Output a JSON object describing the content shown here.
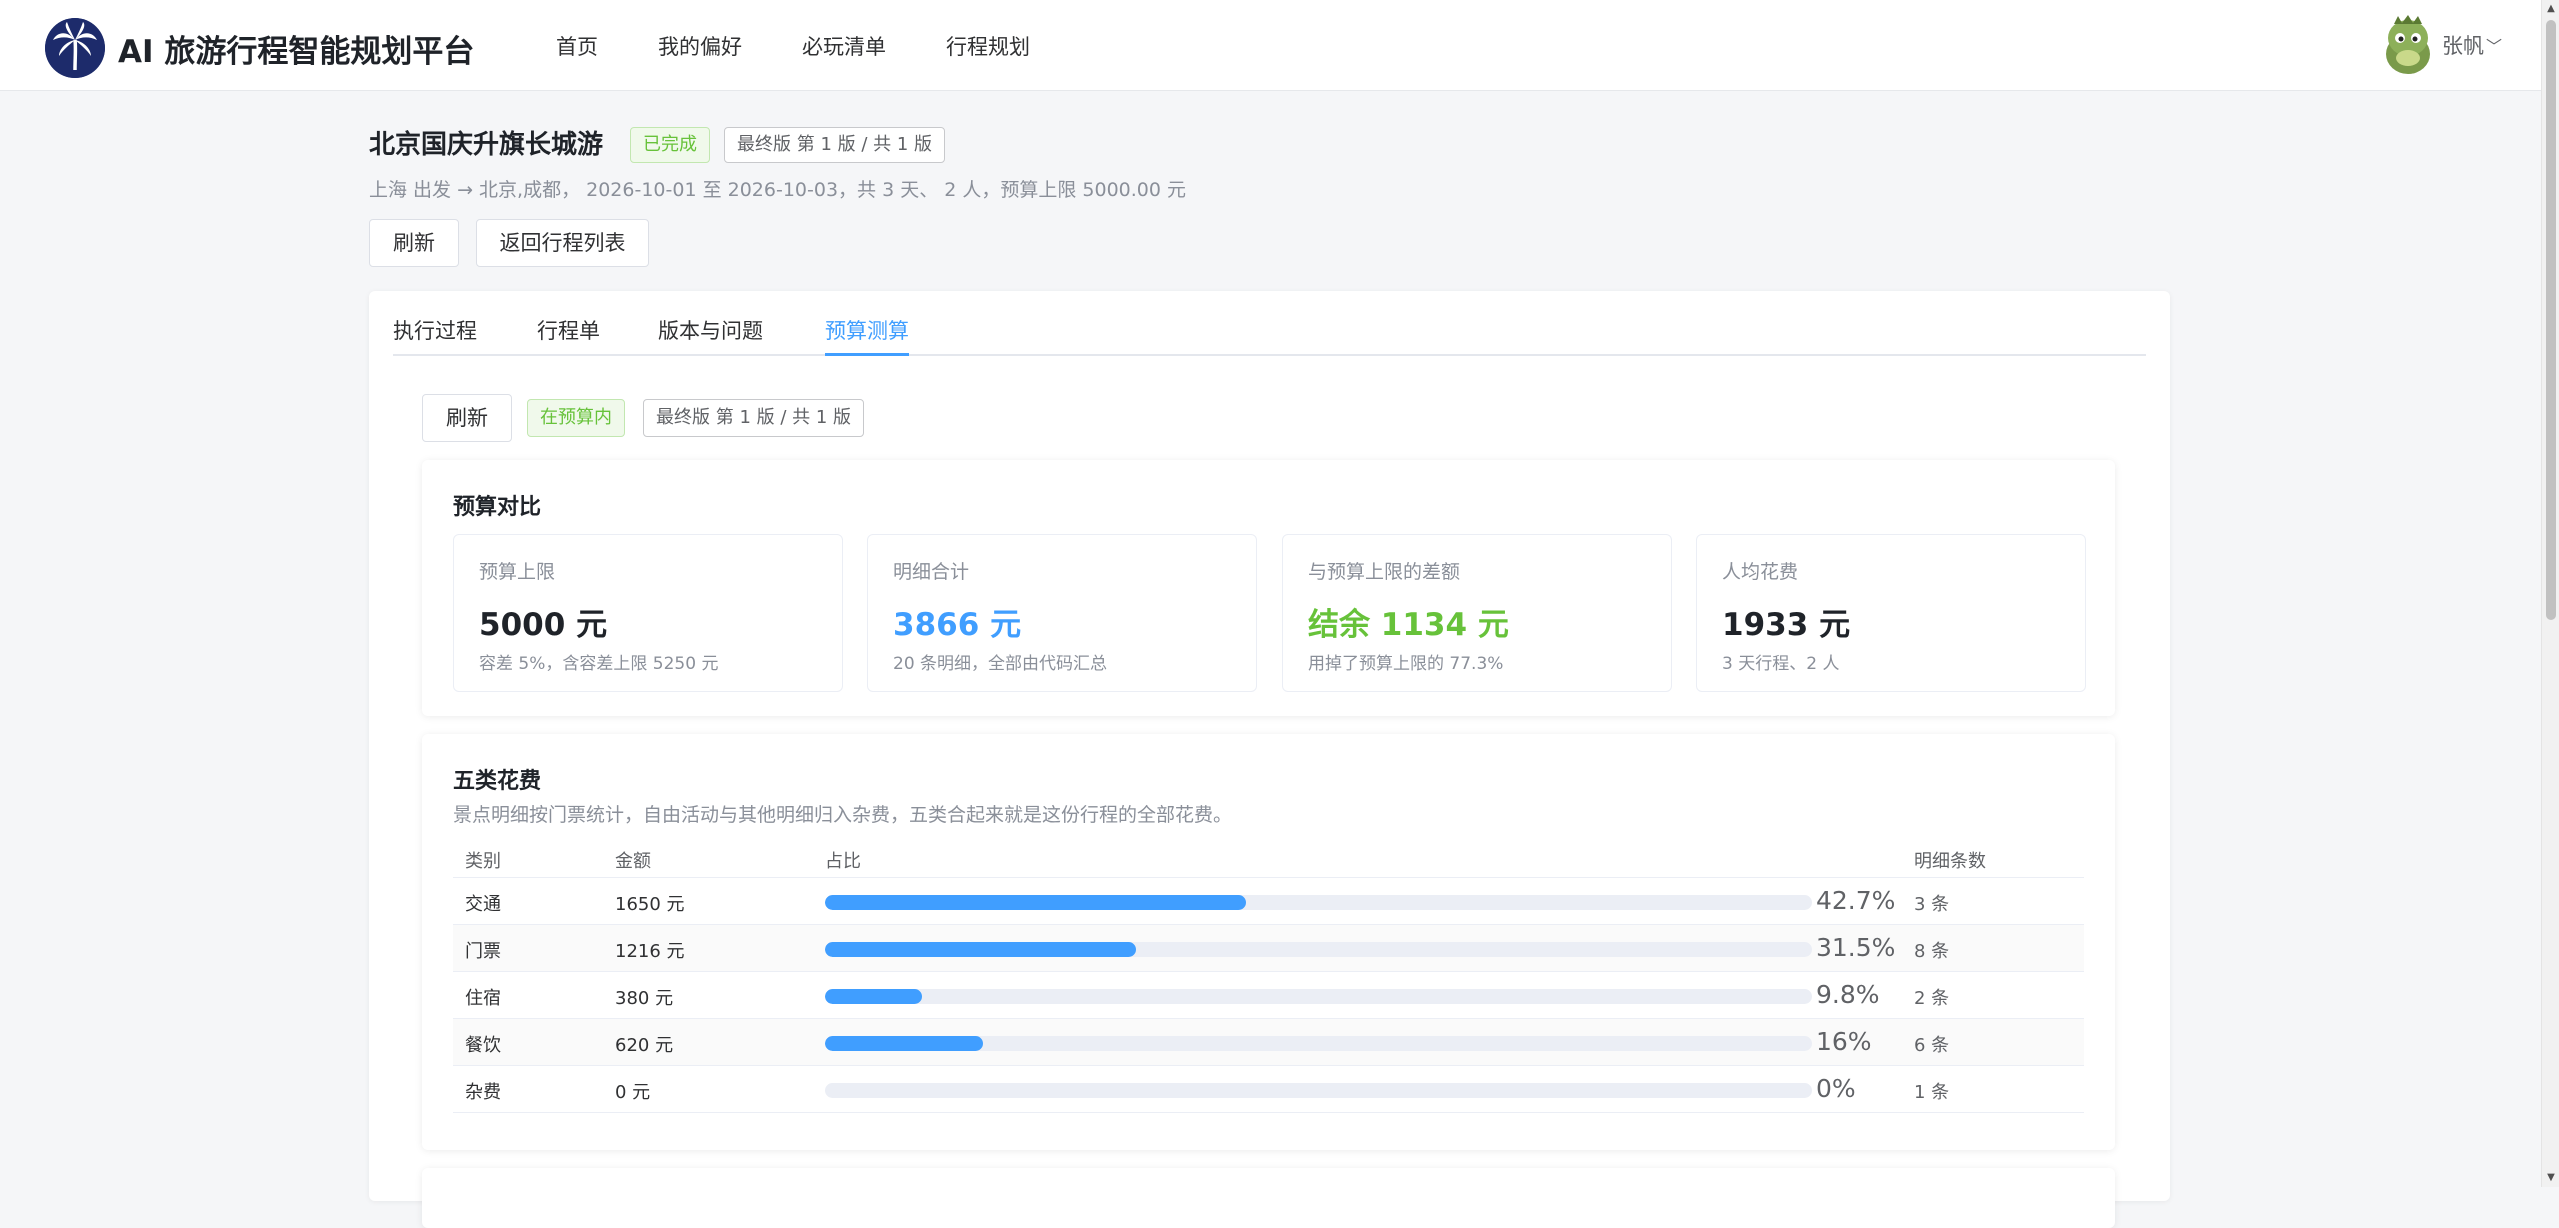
{
  "app": {
    "title": "AI 旅游行程智能规划平台",
    "nav": [
      "首页",
      "我的偏好",
      "必玩清单",
      "行程规划"
    ],
    "user_name": "张帆"
  },
  "trip": {
    "title": "北京国庆升旗长城游",
    "status_tag": "已完成",
    "version_tag": "最终版 第 1 版 / 共 1 版",
    "subtitle": "上海 出发 → 北京,成都， 2026-10-01 至 2026-10-03，共 3 天、 2 人，预算上限 5000.00 元",
    "refresh_label": "刷新",
    "back_label": "返回行程列表"
  },
  "tabs": [
    {
      "label": "执行过程",
      "active": false
    },
    {
      "label": "行程单",
      "active": false
    },
    {
      "label": "版本与问题",
      "active": false
    },
    {
      "label": "预算测算",
      "active": true
    }
  ],
  "budget": {
    "refresh_label": "刷新",
    "status_tag": "在预算内",
    "version_tag": "最终版 第 1 版 / 共 1 版",
    "compare_title": "预算对比",
    "stats": [
      {
        "label": "预算上限",
        "value": "5000 元",
        "note": "容差 5%，含容差上限 5250 元",
        "color": "#1f2329"
      },
      {
        "label": "明细合计",
        "value": "3866 元",
        "note": "20 条明细，全部由代码汇总",
        "color": "#409eff"
      },
      {
        "label": "与预算上限的差额",
        "value": "结余 1134 元",
        "note": "用掉了预算上限的 77.3%",
        "color": "#67c23a"
      },
      {
        "label": "人均花费",
        "value": "1933 元",
        "note": "3 天行程、2 人",
        "color": "#1f2329"
      }
    ],
    "categories_title": "五类花费",
    "categories_desc": "景点明细按门票统计，自由活动与其他明细归入杂费，五类合起来就是这份行程的全部花费。",
    "table_headers": [
      "类别",
      "金额",
      "占比",
      "明细条数"
    ],
    "rows": [
      {
        "category": "交通",
        "amount": "1650 元",
        "percent": 42.7,
        "percent_label": "42.7%",
        "count": "3 条"
      },
      {
        "category": "门票",
        "amount": "1216 元",
        "percent": 31.5,
        "percent_label": "31.5%",
        "count": "8 条"
      },
      {
        "category": "住宿",
        "amount": "380 元",
        "percent": 9.8,
        "percent_label": "9.8%",
        "count": "2 条"
      },
      {
        "category": "餐饮",
        "amount": "620 元",
        "percent": 16,
        "percent_label": "16%",
        "count": "6 条"
      },
      {
        "category": "杂费",
        "amount": "0 元",
        "percent": 0,
        "percent_label": "0%",
        "count": "1 条"
      }
    ]
  }
}
